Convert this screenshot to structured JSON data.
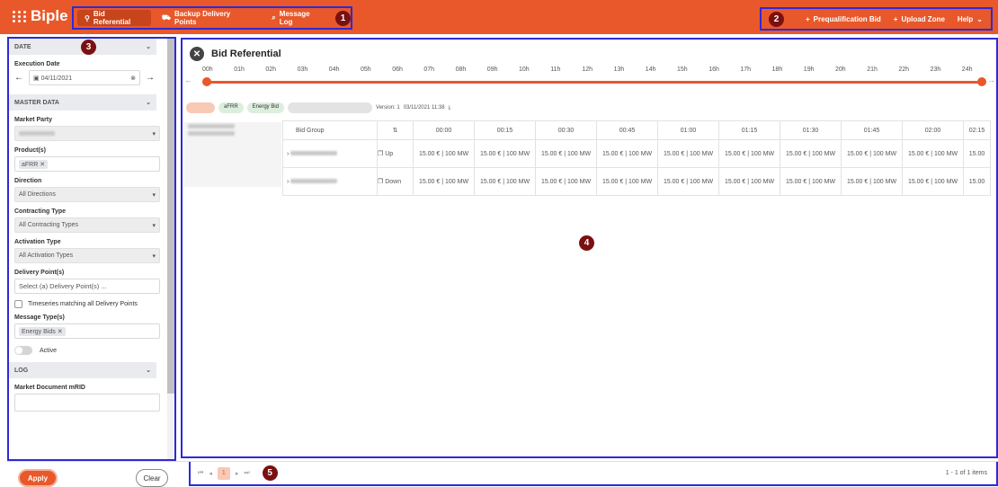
{
  "app": {
    "logo": "Biple"
  },
  "nav": [
    {
      "label": "Bid Referential",
      "icon": "pin-icon"
    },
    {
      "label": "Backup Delivery Points",
      "icon": "delivery-icon"
    },
    {
      "label": "Message Log",
      "icon": "search-icon"
    }
  ],
  "nav_right": [
    {
      "label": "Prequalification Bid"
    },
    {
      "label": "Upload Zone"
    },
    {
      "label": "Help"
    }
  ],
  "markers": [
    "1",
    "2",
    "3",
    "4",
    "5"
  ],
  "sidebar": {
    "date_section": "DATE",
    "execution_date_label": "Execution Date",
    "execution_date_value": "04/11/2021",
    "master_section": "MASTER DATA",
    "market_party_label": "Market Party",
    "products_label": "Product(s)",
    "product_chip": "aFRR",
    "direction_label": "Direction",
    "direction_value": "All Directions",
    "contracting_label": "Contracting Type",
    "contracting_value": "All Contracting Types",
    "activation_label": "Activation Type",
    "activation_value": "All Activation Types",
    "delivery_label": "Delivery Point(s)",
    "delivery_placeholder": "Select (a) Delivery Point(s) ...",
    "timeseries_label": "Timeseries matching all Delivery Points",
    "message_type_label": "Message Type(s)",
    "message_type_chip": "Energy Bids",
    "active_label": "Active",
    "log_section": "LOG",
    "mrid_label": "Market Document mRID"
  },
  "buttons": {
    "apply": "Apply",
    "clear": "Clear"
  },
  "main": {
    "title": "Bid Referential",
    "timeline_ticks": [
      "00h",
      "01h",
      "02h",
      "03h",
      "04h",
      "05h",
      "06h",
      "07h",
      "08h",
      "09h",
      "10h",
      "11h",
      "12h",
      "13h",
      "14h",
      "15h",
      "16h",
      "17h",
      "18h",
      "19h",
      "20h",
      "21h",
      "22h",
      "23h",
      "24h"
    ],
    "filter_tags": [
      "aFRR",
      "Energy Bid"
    ],
    "version": "Version: 1",
    "datetime": "03/11/2021 11:38",
    "table": {
      "group_header": "Bid Group",
      "time_headers": [
        "00:00",
        "00:15",
        "00:30",
        "00:45",
        "01:00",
        "01:15",
        "01:30",
        "01:45",
        "02:00",
        "02:15"
      ],
      "rows": [
        {
          "direction": "Up",
          "values": [
            "15.00 € | 100 MW",
            "15.00 € | 100 MW",
            "15.00 € | 100 MW",
            "15.00 € | 100 MW",
            "15.00 € | 100 MW",
            "15.00 € | 100 MW",
            "15.00 € | 100 MW",
            "15.00 € | 100 MW",
            "15.00 € | 100 MW",
            "15.00"
          ]
        },
        {
          "direction": "Down",
          "values": [
            "15.00 € | 100 MW",
            "15.00 € | 100 MW",
            "15.00 € | 100 MW",
            "15.00 € | 100 MW",
            "15.00 € | 100 MW",
            "15.00 € | 100 MW",
            "15.00 € | 100 MW",
            "15.00 € | 100 MW",
            "15.00 € | 100 MW",
            "15.00"
          ]
        }
      ]
    }
  },
  "pager": {
    "current": "1",
    "summary": "1 - 1 of 1 items"
  }
}
